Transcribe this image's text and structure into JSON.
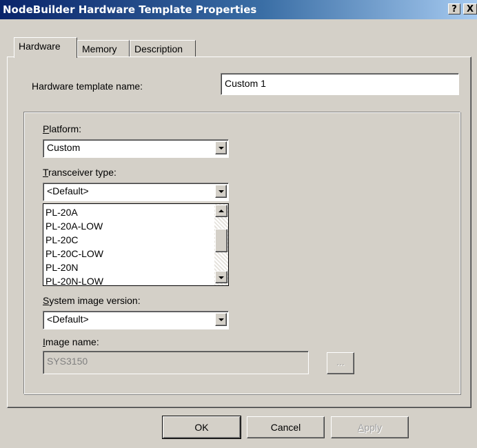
{
  "window": {
    "title": "NodeBuilder Hardware Template Properties",
    "help_glyph": "?",
    "close_glyph": "X"
  },
  "tabs": [
    {
      "label": "Hardware",
      "active": true
    },
    {
      "label": "Memory",
      "active": false
    },
    {
      "label": "Description",
      "active": false
    }
  ],
  "hardware": {
    "template_name_label": "Hardware template name:",
    "template_name_value": "Custom 1",
    "platform": {
      "accesskey": "P",
      "label_rest": "latform:",
      "value": "Custom"
    },
    "transceiver": {
      "accesskey": "T",
      "label_rest": "ransceiver type:",
      "value": "<Default>",
      "list_items": [
        "PL-20A",
        "PL-20A-LOW",
        "PL-20C",
        "PL-20C-LOW",
        "PL-20N",
        "PL-20N-LOW"
      ]
    },
    "system_image": {
      "accesskey": "S",
      "label_rest": "ystem image version:",
      "value": "<Default>"
    },
    "image_name": {
      "accesskey": "I",
      "label_rest": "mage name:",
      "value": "SYS3150",
      "browse_label": "..."
    }
  },
  "buttons": {
    "ok": "OK",
    "cancel": "Cancel",
    "apply_accesskey": "A",
    "apply_rest": "pply"
  }
}
